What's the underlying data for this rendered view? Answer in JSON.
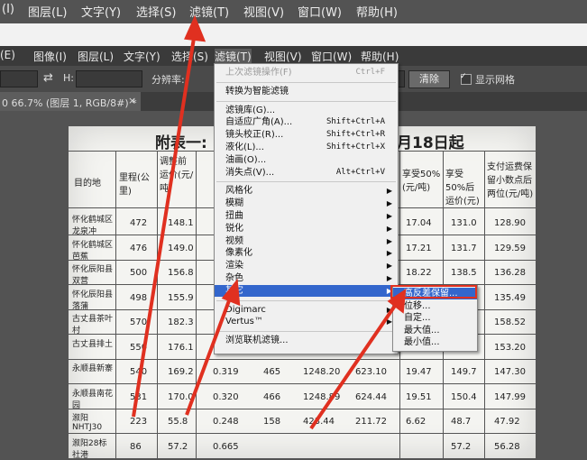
{
  "top_menu": [
    "(I)",
    "图层(L)",
    "文字(Y)",
    "选择(S)",
    "滤镜(T)",
    "视图(V)",
    "窗口(W)",
    "帮助(H)"
  ],
  "menu_bar": [
    "(E)",
    "图像(I)",
    "图层(L)",
    "文字(Y)",
    "选择(S)",
    "滤镜(T)",
    "视图(V)",
    "窗口(W)",
    "帮助(H)"
  ],
  "options_bar": {
    "h_label": "H:",
    "resolution_label": "分辨率:",
    "clear_button": "清除",
    "show_grid_label": "显示网格"
  },
  "doc_tab": "0 66.7% (图层 1, RGB/8#) *",
  "doc_tab_close": "×",
  "filter_menu": {
    "items": [
      {
        "label": "上次滤镜操作(F)",
        "shortcut": "Ctrl+F",
        "disabled": true
      },
      {
        "sep": true
      },
      {
        "label": "转换为智能滤镜"
      },
      {
        "sep": true
      },
      {
        "label": "滤镜库(G)..."
      },
      {
        "label": "自适应广角(A)...",
        "shortcut": "Shift+Ctrl+A"
      },
      {
        "label": "镜头校正(R)...",
        "shortcut": "Shift+Ctrl+R"
      },
      {
        "label": "液化(L)...",
        "shortcut": "Shift+Ctrl+X"
      },
      {
        "label": "油画(O)..."
      },
      {
        "label": "消失点(V)...",
        "shortcut": "Alt+Ctrl+V"
      },
      {
        "sep": true
      },
      {
        "label": "风格化",
        "sub": true
      },
      {
        "label": "模糊",
        "sub": true
      },
      {
        "label": "扭曲",
        "sub": true
      },
      {
        "label": "锐化",
        "sub": true
      },
      {
        "label": "视频",
        "sub": true
      },
      {
        "label": "像素化",
        "sub": true
      },
      {
        "label": "渲染",
        "sub": true
      },
      {
        "label": "杂色",
        "sub": true
      },
      {
        "label": "其它",
        "sub": true,
        "highlight": true
      },
      {
        "sep": true
      },
      {
        "label": "Digimarc",
        "sub": true
      },
      {
        "label": "Vertus™",
        "sub": true
      },
      {
        "sep": true
      },
      {
        "label": "浏览联机滤镜..."
      }
    ]
  },
  "submenu": {
    "items": [
      {
        "label": "高反差保留...",
        "highlight": true
      },
      {
        "label": "位移..."
      },
      {
        "label": "自定..."
      },
      {
        "label": "最大值..."
      },
      {
        "label": "最小值..."
      }
    ]
  },
  "document": {
    "title_left": "附表一:",
    "title_right": "月18日起",
    "headers": {
      "destination": "目的地",
      "mileage": "里程(公里)",
      "pre_adjust": "调整前运价(元/吨)",
      "post_adjust_col": "享受50%(元/吨)",
      "after_price": "享受50%后运价(元)",
      "payable": "支付运费保留小数点后两位(元/吨)"
    },
    "rows": [
      {
        "dest": "怀化鹤城区龙泉冲",
        "km": "472",
        "pre": "148.1",
        "r50": "17.04",
        "after": "131.0",
        "pay": "128.90"
      },
      {
        "dest": "怀化鹤城区芭蕉",
        "km": "476",
        "pre": "149.0",
        "r50": "17.21",
        "after": "131.7",
        "pay": "129.59"
      },
      {
        "dest": "怀化辰阳县双营",
        "km": "500",
        "pre": "156.8",
        "r50": "18.22",
        "after": "138.5",
        "pay": "136.28"
      },
      {
        "dest": "怀化辰阳县落蒲",
        "km": "498",
        "pre": "155.9",
        "r50": "",
        "after": "",
        "pay": "135.49"
      },
      {
        "dest": "古丈县茶叶村",
        "km": "570",
        "pre": "182.3",
        "r50": "",
        "after": "",
        "pay": "158.52"
      },
      {
        "dest": "古丈县排土",
        "km": "550",
        "pre": "176.1",
        "r50": "",
        "after": "",
        "pay": "153.20"
      },
      {
        "dest": "永顺县新寨",
        "km": "540",
        "pre": "169.2",
        "c3": "0.319",
        "c4": "465",
        "c5": "1248.20",
        "c6": "623.10",
        "r50": "19.47",
        "after": "149.7",
        "pay": "147.30"
      },
      {
        "dest": "永顺县南花园",
        "km": "531",
        "pre": "170.0",
        "c3": "0.320",
        "c4": "466",
        "c5": "1248.89",
        "c6": "624.44",
        "r50": "19.51",
        "after": "150.4",
        "pay": "147.99"
      },
      {
        "dest": "溆阳NHTJ30",
        "km": "223",
        "pre": "55.8",
        "c3": "0.248",
        "c4": "158",
        "c5": "423.44",
        "c6": "211.72",
        "r50": "6.62",
        "after": "48.7",
        "pay": "47.92"
      },
      {
        "dest": "溆阳28标社港",
        "km": "86",
        "pre": "57.2",
        "c3": "0.665",
        "c4": "",
        "c5": "",
        "c6": "",
        "r50": "",
        "after": "57.2",
        "pay": "56.28"
      }
    ]
  },
  "colors": {
    "menu_highlight": "#3366cc",
    "annotation_red": "#e03020"
  }
}
